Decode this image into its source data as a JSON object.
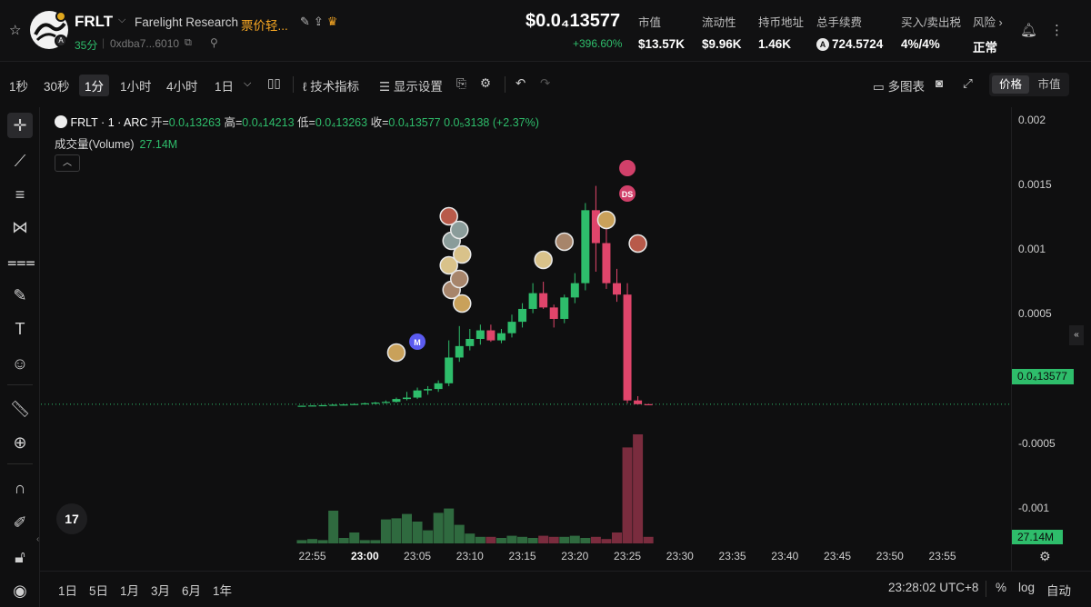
{
  "header": {
    "token_symbol": "FRLT",
    "token_name": "Farelight Research",
    "warning": "票价轻...",
    "age": "35分",
    "address": "0xdba7...6010",
    "price": "$0.0₄13577",
    "price_change": "+396.60%",
    "stats": [
      {
        "label": "市值",
        "value": "$13.57K"
      },
      {
        "label": "流动性",
        "value": "$9.96K"
      },
      {
        "label": "持币地址",
        "value": "1.46K"
      },
      {
        "label": "总手续费",
        "value": "724.5724"
      },
      {
        "label": "买入/卖出税",
        "value": "4%/4%"
      },
      {
        "label": "风险 ›",
        "value": "正常"
      }
    ]
  },
  "toolbar": {
    "intervals": [
      "1秒",
      "30秒",
      "1分",
      "1小时",
      "4小时",
      "1日"
    ],
    "active_interval": "1分",
    "indicators": "技术指标",
    "display_settings": "显示设置",
    "multi_chart": "多图表",
    "price_tab": "价格",
    "mcap_tab": "市值"
  },
  "legend": {
    "symbol": "FRLT · 1 · ARC",
    "open_label": "开=",
    "open": "0.0₄13263",
    "high_label": "高=",
    "high": "0.0₄14213",
    "low_label": "低=",
    "low": "0.0₄13263",
    "close_label": "收=",
    "close": "0.0₄13577",
    "change": "0.0₅3138 (+2.37%)",
    "volume_label": "成交量(Volume)",
    "volume_value": "27.14M"
  },
  "yaxis": {
    "ticks": [
      "0.002",
      "0.0015",
      "0.001",
      "0.0005",
      "-0.0005",
      "-0.001"
    ],
    "price_tag": "0.0₄13577",
    "volume_tag": "27.14M"
  },
  "xaxis": {
    "ticks": [
      "22:55",
      "23:00",
      "23:05",
      "23:10",
      "23:15",
      "23:20",
      "23:25",
      "23:30",
      "23:35",
      "23:40",
      "23:45",
      "23:50",
      "23:55"
    ]
  },
  "bottom": {
    "ranges": [
      "1日",
      "5日",
      "1月",
      "3月",
      "6月",
      "1年"
    ],
    "clock": "23:28:02 UTC+8",
    "percent": "%",
    "log": "log",
    "auto": "自动"
  },
  "colors": {
    "up": "#2ebd6b",
    "down": "#e0456b",
    "vol_up": "#2f6a3f",
    "vol_down": "#7a2c3e",
    "markers": {
      "M": "#5b5bf0",
      "DS": "#d1406a"
    }
  },
  "chart_data": {
    "type": "candlestick",
    "ylim": [
      -0.00115,
      0.00209
    ],
    "x": [
      "22:54",
      "22:55",
      "22:56",
      "22:57",
      "22:58",
      "22:59",
      "23:00",
      "23:01",
      "23:02",
      "23:03",
      "23:04",
      "23:05",
      "23:06",
      "23:07",
      "23:08",
      "23:09",
      "23:10",
      "23:11",
      "23:12",
      "23:13",
      "23:14",
      "23:15",
      "23:16",
      "23:17",
      "23:18",
      "23:19",
      "23:20",
      "23:21",
      "23:22",
      "23:23",
      "23:24",
      "23:25",
      "23:26",
      "23:27"
    ],
    "candles": [
      [
        2e-06,
        4e-06,
        1e-06,
        3e-06
      ],
      [
        3e-06,
        6e-06,
        2e-06,
        5e-06
      ],
      [
        5e-06,
        8e-06,
        4e-06,
        7e-06
      ],
      [
        7e-06,
        1.2e-05,
        6e-06,
        1e-05
      ],
      [
        1e-05,
        1.5e-05,
        8e-06,
        1.2e-05
      ],
      [
        1.2e-05,
        2e-05,
        1e-05,
        1.5e-05
      ],
      [
        1.5e-05,
        2.5e-05,
        1.2e-05,
        2e-05
      ],
      [
        2e-05,
        3e-05,
        1.5e-05,
        2.5e-05
      ],
      [
        2.5e-05,
        4e-05,
        2e-05,
        3e-05
      ],
      [
        3e-05,
        6e-05,
        2.5e-05,
        5e-05
      ],
      [
        5e-05,
        0.0001,
        4e-05,
        6e-05
      ],
      [
        6e-05,
        0.00013,
        5e-05,
        0.00011
      ],
      [
        0.00011,
        0.00014,
        8e-05,
        0.00012
      ],
      [
        0.00012,
        0.00018,
        0.0001,
        0.00016
      ],
      [
        0.00016,
        0.00046,
        0.00014,
        0.00034
      ],
      [
        0.00034,
        0.00056,
        0.00031,
        0.00042
      ],
      [
        0.00042,
        0.00054,
        0.00039,
        0.00047
      ],
      [
        0.00047,
        0.00057,
        0.00043,
        0.00053
      ],
      [
        0.00053,
        0.00057,
        0.00045,
        0.00046
      ],
      [
        0.00046,
        0.00054,
        0.00044,
        0.00051
      ],
      [
        0.00051,
        0.00064,
        0.00048,
        0.00059
      ],
      [
        0.00059,
        0.00072,
        0.00055,
        0.00068
      ],
      [
        0.00068,
        0.00086,
        0.00065,
        0.00079
      ],
      [
        0.00079,
        0.00087,
        0.00068,
        0.00069
      ],
      [
        0.00069,
        0.00071,
        0.00055,
        0.00061
      ],
      [
        0.00061,
        0.00078,
        0.00058,
        0.00076
      ],
      [
        0.00076,
        0.00093,
        0.00072,
        0.00086
      ],
      [
        0.00086,
        0.00142,
        0.00081,
        0.00137
      ],
      [
        0.00137,
        0.00154,
        0.00094,
        0.00114
      ],
      [
        0.00114,
        0.00128,
        0.00082,
        0.00086
      ],
      [
        0.00086,
        0.00096,
        0.00073,
        0.00078
      ],
      [
        0.00078,
        0.00086,
        2e-05,
        4e-05
      ],
      [
        4e-05,
        7e-05,
        1.2e-05,
        1.4e-05
      ],
      [
        1.4e-05,
        1.6e-05,
        1.3e-05,
        1.36e-05
      ]
    ],
    "volume": [
      3,
      4,
      3,
      30,
      5,
      10,
      3,
      3,
      22,
      23,
      27,
      20,
      12,
      28,
      32,
      17,
      9,
      6,
      6,
      5,
      7,
      6,
      5,
      7,
      6,
      6,
      7,
      5,
      6,
      4,
      10,
      88,
      100,
      6
    ],
    "volume_scale_max": "27.14M",
    "markers": [
      {
        "x": "23:03",
        "type": "avatar"
      },
      {
        "x": "23:05",
        "type": "label",
        "text": "M"
      },
      {
        "x": "23:08",
        "type": "avatar"
      },
      {
        "x": "23:09",
        "type": "avatar"
      },
      {
        "x": "23:17",
        "type": "avatar"
      },
      {
        "x": "23:19",
        "type": "avatar"
      },
      {
        "x": "23:23",
        "type": "avatar"
      },
      {
        "x": "23:25",
        "type": "label",
        "text": "DS"
      },
      {
        "x": "23:26",
        "type": "avatar"
      }
    ]
  }
}
